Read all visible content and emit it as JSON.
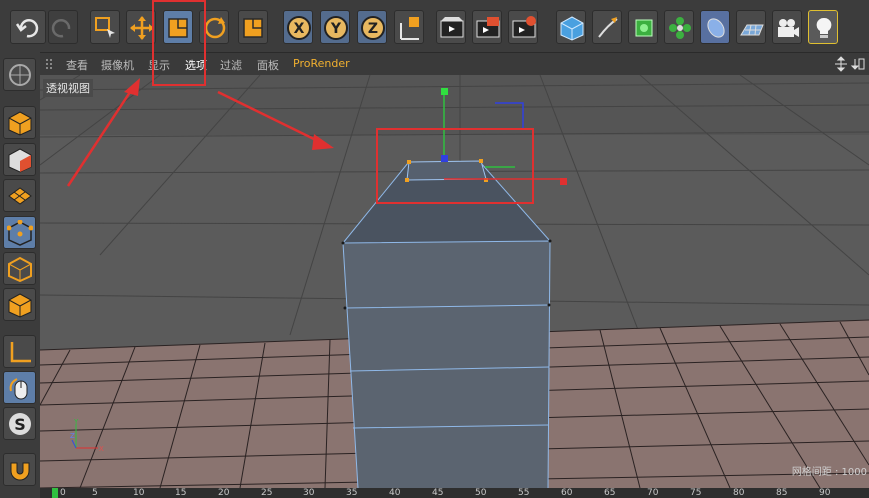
{
  "menubar": {
    "items": [
      "查看",
      "摄像机",
      "显示",
      "选项",
      "过滤",
      "面板",
      "ProRender"
    ]
  },
  "viewport": {
    "label": "透视视图",
    "grid_spacing_label": "网格间距 : 1000",
    "axis_labels": [
      "Y",
      "Z",
      "X"
    ]
  },
  "timeline": {
    "ticks": [
      "0",
      "5",
      "10",
      "15",
      "20",
      "25",
      "30",
      "35",
      "40",
      "45",
      "50",
      "55",
      "60",
      "65",
      "70",
      "75",
      "80",
      "85",
      "90"
    ]
  },
  "toolbar": {
    "icons": [
      "undo-icon",
      "redo-icon",
      "live-select-icon",
      "move-icon",
      "scale-icon",
      "rotate-icon",
      "recent-tool-icon",
      "x-axis-lock-icon",
      "y-axis-lock-icon",
      "z-axis-lock-icon",
      "coordinate-system-icon",
      "render-view-icon",
      "render-picture-viewer-icon",
      "render-settings-icon",
      "cube-object-icon",
      "pen-spline-icon",
      "subdivision-icon",
      "array-icon",
      "deformer-icon",
      "floor-icon",
      "camera-icon",
      "light-icon"
    ]
  },
  "sidebar": {
    "icons": [
      "viewport-solo-icon",
      "model-mode-icon",
      "texture-mode-icon",
      "workplane-icon",
      "points-mode-icon",
      "edges-mode-icon",
      "polygons-mode-icon",
      "axis-mode-icon",
      "tweak-mode-icon",
      "snap-icon",
      "magnet-icon"
    ]
  },
  "colors": {
    "highlight_box": "#e03030",
    "active_tool": "#5e7ea8",
    "accent_orange": "#f0a020",
    "floor": "#8a7470",
    "mesh": "#5b6470"
  }
}
